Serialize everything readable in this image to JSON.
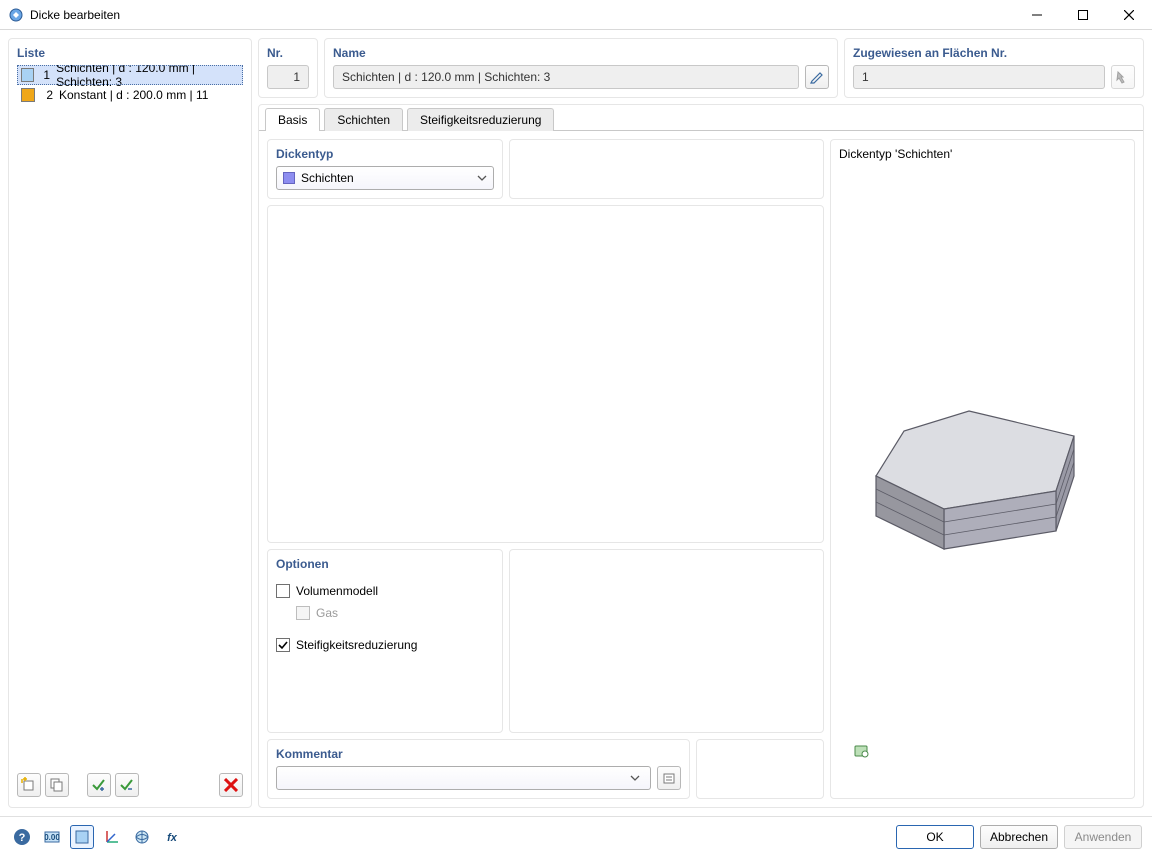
{
  "window": {
    "title": "Dicke bearbeiten"
  },
  "left": {
    "liste_label": "Liste",
    "items": [
      {
        "idx": "1",
        "label": "Schichten | d : 120.0 mm | Schichten: 3",
        "color": "#a9d2f4",
        "selected": true
      },
      {
        "idx": "2",
        "label": "Konstant | d : 200.0 mm | 11",
        "color": "#f0a718",
        "selected": false
      }
    ]
  },
  "top": {
    "nr_label": "Nr.",
    "nr_value": "1",
    "name_label": "Name",
    "name_value": "Schichten | d : 120.0 mm | Schichten: 3",
    "assigned_label": "Zugewiesen an Flächen Nr.",
    "assigned_value": "1"
  },
  "tabs": {
    "basis": "Basis",
    "schichten": "Schichten",
    "steif": "Steifigkeitsreduzierung",
    "active": "basis"
  },
  "dickentyp": {
    "label": "Dickentyp",
    "value": "Schichten"
  },
  "optionen": {
    "label": "Optionen",
    "volumen": "Volumenmodell",
    "gas": "Gas",
    "steif": "Steifigkeitsreduzierung"
  },
  "kommentar": {
    "label": "Kommentar"
  },
  "preview": {
    "label": "Dickentyp  'Schichten'"
  },
  "footer": {
    "ok": "OK",
    "cancel": "Abbrechen",
    "apply": "Anwenden"
  }
}
